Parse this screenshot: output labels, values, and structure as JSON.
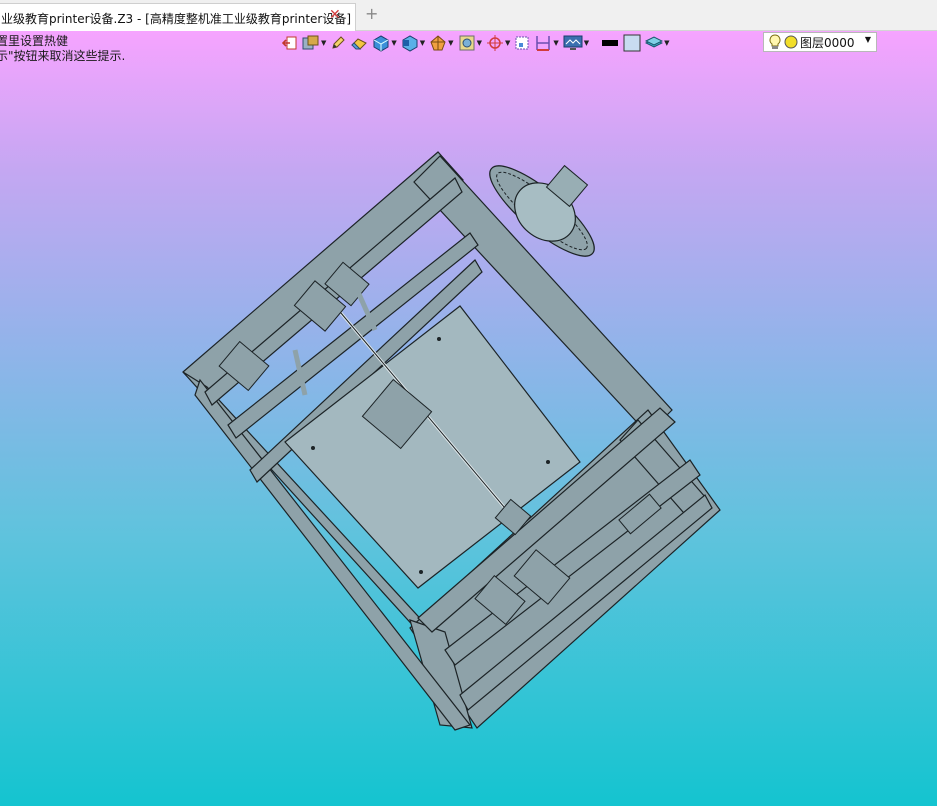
{
  "tab": {
    "title": "业级教育printer设备.Z3 - [高精度整机准工业级教育printer设备]",
    "close_glyph": "✕",
    "new_tab_glyph": "+"
  },
  "hint": {
    "line1": "置里设置热健",
    "line2": "示\"按钮来取消这些提示."
  },
  "toolbar": {
    "icons": [
      "exit-part-icon",
      "history-icon",
      "pencil-icon",
      "eraser-icon",
      "solid-box-icon",
      "view-cube-icon",
      "render-mode-icon",
      "frame-icon",
      "snap-point-icon",
      "clip-view-icon",
      "dimension-icon",
      "display-monitor-icon",
      "line-color-swatch",
      "fill-color-swatch",
      "layer-stack-icon"
    ],
    "line_color": "#000000",
    "fill_color": "#c8dcf0"
  },
  "layer": {
    "name": "图层0000",
    "bulb_icon": "lightbulb-icon",
    "color_dot": "#f2de2a"
  },
  "viewport": {
    "gradient_top": "#f6a4ff",
    "gradient_bottom": "#14c4d0",
    "model_fill": "#8fa3aa",
    "model_edge": "#1c2326"
  }
}
